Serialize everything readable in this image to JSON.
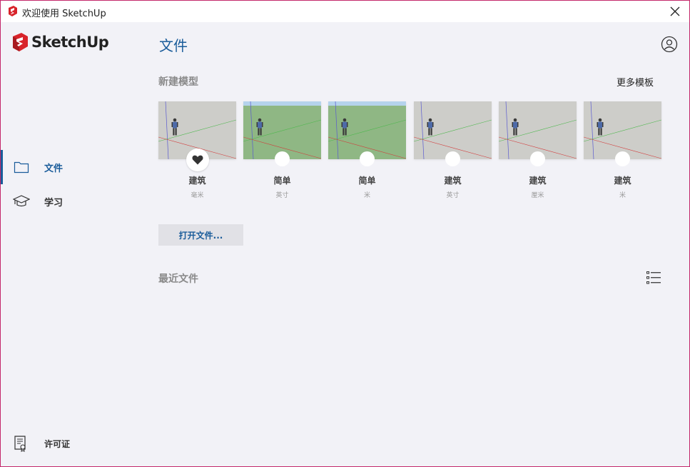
{
  "window": {
    "title": "欢迎使用 SketchUp",
    "accent": "#c4286b"
  },
  "sidebar": {
    "logo_text": "SketchUp",
    "items": [
      {
        "label": "文件",
        "icon": "folder-icon",
        "active": true
      },
      {
        "label": "学习",
        "icon": "graduation-cap-icon",
        "active": false
      }
    ],
    "license_label": "许可证"
  },
  "main": {
    "title": "文件",
    "new_model_label": "新建模型",
    "more_templates_label": "更多模板",
    "templates": [
      {
        "name": "建筑",
        "unit": "毫米",
        "style": "gray",
        "favorite": true
      },
      {
        "name": "简单",
        "unit": "英寸",
        "style": "green",
        "favorite": false
      },
      {
        "name": "简单",
        "unit": "米",
        "style": "green",
        "favorite": false
      },
      {
        "name": "建筑",
        "unit": "英寸",
        "style": "gray",
        "favorite": false
      },
      {
        "name": "建筑",
        "unit": "厘米",
        "style": "gray",
        "favorite": false
      },
      {
        "name": "建筑",
        "unit": "米",
        "style": "gray",
        "favorite": false
      }
    ],
    "open_file_label": "打开文件...",
    "recent_files_label": "最近文件"
  },
  "colors": {
    "primary": "#1a5c9a",
    "background": "#f2f2f7",
    "thumb_gray": "#cdcdc9",
    "thumb_green": "#8fb784",
    "thumb_sky": "#b5d3ec"
  }
}
